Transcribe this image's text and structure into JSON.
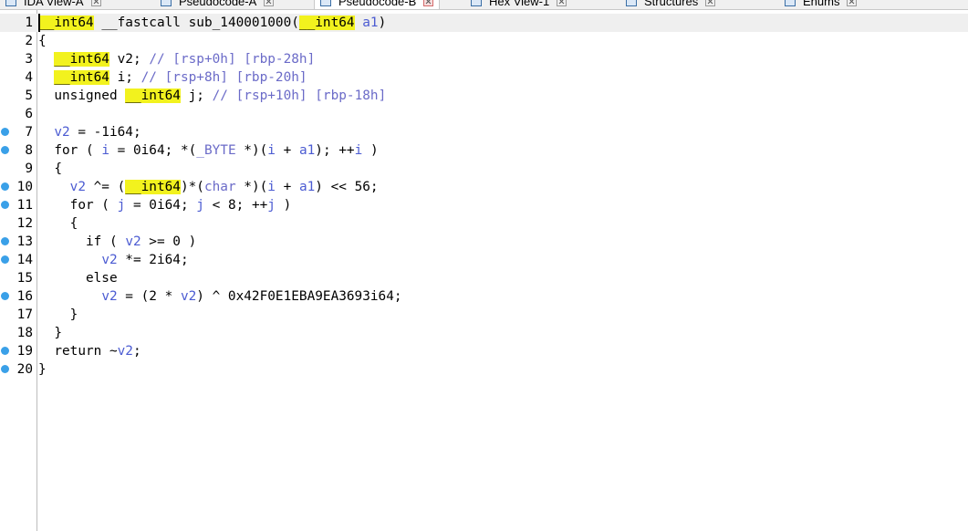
{
  "tabs": [
    {
      "label": "IDA View-A",
      "active": false
    },
    {
      "label": "Pseudocode-A",
      "active": false
    },
    {
      "label": "Pseudocode-B",
      "active": true
    },
    {
      "label": "Hex View-1",
      "active": false
    },
    {
      "label": "Structures",
      "active": false
    },
    {
      "label": "Enums",
      "active": false
    }
  ],
  "colors": {
    "highlight": "#f2f21e",
    "variable": "#4b5bd2",
    "breakpoint_dot": "#3aa0e8"
  },
  "code": {
    "lines": [
      {
        "num": "1",
        "dot": false,
        "segments": [
          [
            "ty",
            "__int64"
          ],
          [
            "p",
            " __fastcall sub_140001000("
          ],
          [
            "ty",
            "__int64"
          ],
          [
            "var",
            " a1"
          ],
          [
            "p",
            ")"
          ]
        ]
      },
      {
        "num": "2",
        "dot": false,
        "segments": [
          [
            "p",
            "{"
          ]
        ]
      },
      {
        "num": "3",
        "dot": false,
        "segments": [
          [
            "p",
            "  "
          ],
          [
            "ty",
            "__int64"
          ],
          [
            "p",
            " v2; "
          ],
          [
            "cmt",
            "// [rsp+0h] [rbp-28h]"
          ]
        ]
      },
      {
        "num": "4",
        "dot": false,
        "segments": [
          [
            "p",
            "  "
          ],
          [
            "ty",
            "__int64"
          ],
          [
            "p",
            " i; "
          ],
          [
            "cmt",
            "// [rsp+8h] [rbp-20h]"
          ]
        ]
      },
      {
        "num": "5",
        "dot": false,
        "segments": [
          [
            "p",
            "  unsigned "
          ],
          [
            "ty",
            "__int64"
          ],
          [
            "p",
            " j; "
          ],
          [
            "cmt",
            "// [rsp+10h] [rbp-18h]"
          ]
        ]
      },
      {
        "num": "6",
        "dot": false,
        "segments": [
          [
            "p",
            ""
          ]
        ]
      },
      {
        "num": "7",
        "dot": true,
        "segments": [
          [
            "p",
            "  "
          ],
          [
            "var",
            "v2"
          ],
          [
            "p",
            " = -1i64;"
          ]
        ]
      },
      {
        "num": "8",
        "dot": true,
        "segments": [
          [
            "p",
            "  for ( "
          ],
          [
            "var",
            "i"
          ],
          [
            "p",
            " = 0i64; *("
          ],
          [
            "cmt",
            "_BYTE"
          ],
          [
            "p",
            " *)("
          ],
          [
            "var",
            "i"
          ],
          [
            "p",
            " + "
          ],
          [
            "var",
            "a1"
          ],
          [
            "p",
            "); ++"
          ],
          [
            "var",
            "i"
          ],
          [
            "p",
            " )"
          ]
        ]
      },
      {
        "num": "9",
        "dot": false,
        "segments": [
          [
            "p",
            "  {"
          ]
        ]
      },
      {
        "num": "10",
        "dot": true,
        "segments": [
          [
            "p",
            "    "
          ],
          [
            "var",
            "v2"
          ],
          [
            "p",
            " ^= ("
          ],
          [
            "ty",
            "__int64"
          ],
          [
            "p",
            ")*("
          ],
          [
            "cmt",
            "char"
          ],
          [
            "p",
            " *)("
          ],
          [
            "var",
            "i"
          ],
          [
            "p",
            " + "
          ],
          [
            "var",
            "a1"
          ],
          [
            "p",
            ") << 56;"
          ]
        ]
      },
      {
        "num": "11",
        "dot": true,
        "segments": [
          [
            "p",
            "    for ( "
          ],
          [
            "var",
            "j"
          ],
          [
            "p",
            " = 0i64; "
          ],
          [
            "var",
            "j"
          ],
          [
            "p",
            " < 8; ++"
          ],
          [
            "var",
            "j"
          ],
          [
            "p",
            " )"
          ]
        ]
      },
      {
        "num": "12",
        "dot": false,
        "segments": [
          [
            "p",
            "    {"
          ]
        ]
      },
      {
        "num": "13",
        "dot": true,
        "segments": [
          [
            "p",
            "      if ( "
          ],
          [
            "var",
            "v2"
          ],
          [
            "p",
            " >= 0 )"
          ]
        ]
      },
      {
        "num": "14",
        "dot": true,
        "segments": [
          [
            "p",
            "        "
          ],
          [
            "var",
            "v2"
          ],
          [
            "p",
            " *= 2i64;"
          ]
        ]
      },
      {
        "num": "15",
        "dot": false,
        "segments": [
          [
            "p",
            "      else"
          ]
        ]
      },
      {
        "num": "16",
        "dot": true,
        "segments": [
          [
            "p",
            "        "
          ],
          [
            "var",
            "v2"
          ],
          [
            "p",
            " = (2 * "
          ],
          [
            "var",
            "v2"
          ],
          [
            "p",
            ") ^ 0x42F0E1EBA9EA3693i64;"
          ]
        ]
      },
      {
        "num": "17",
        "dot": false,
        "segments": [
          [
            "p",
            "    }"
          ]
        ]
      },
      {
        "num": "18",
        "dot": false,
        "segments": [
          [
            "p",
            "  }"
          ]
        ]
      },
      {
        "num": "19",
        "dot": true,
        "segments": [
          [
            "p",
            "  return ~"
          ],
          [
            "var",
            "v2"
          ],
          [
            "p",
            ";"
          ]
        ]
      },
      {
        "num": "20",
        "dot": true,
        "segments": [
          [
            "p",
            "}"
          ]
        ]
      }
    ]
  }
}
